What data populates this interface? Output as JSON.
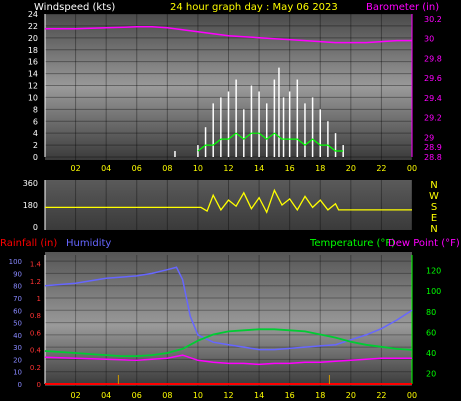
{
  "header": {
    "left": "Windspeed (kts)",
    "center": "24 hour graph day : May 06 2023",
    "right": "Barometer (in)"
  },
  "bottom_header": {
    "rainfall": "Rainfall (in)",
    "humidity": "Humidity",
    "temperature": "Temperature (°F)",
    "dewpoint": "Dew Point (°F)"
  },
  "colors": {
    "background": "#000000",
    "wind": "#ffffff",
    "gust": "#00ff00",
    "barometer": "#ff00ff",
    "direction": "#ffff00",
    "rain": "#ff0000",
    "humidity": "#6666ff",
    "temperature": "#00cc33",
    "dewpoint": "#ff00ff",
    "header": "#ffff00"
  },
  "chart_data": [
    {
      "type": "line",
      "name": "wind-barometer",
      "xticks": [
        "02",
        "04",
        "06",
        "08",
        "10",
        "12",
        "14",
        "16",
        "18",
        "20",
        "22",
        "00"
      ],
      "xlim": [
        0,
        24
      ],
      "y_left_ticks": [
        "0",
        "2",
        "4",
        "6",
        "8",
        "10",
        "12",
        "14",
        "16",
        "18",
        "20",
        "22",
        "24"
      ],
      "ylim_left": [
        0,
        24
      ],
      "y_right_ticks": [
        "28.8",
        "28.9",
        "29",
        "29.2",
        "29.4",
        "29.6",
        "29.8",
        "30",
        "30.2"
      ],
      "ylim_right": [
        28.8,
        30.25
      ],
      "barometer": {
        "x": [
          0,
          2,
          4,
          6,
          7,
          8,
          9,
          10,
          11,
          12,
          13,
          14,
          15,
          16,
          17,
          18,
          19,
          20,
          21,
          22,
          23,
          24
        ],
        "y": [
          30.1,
          30.1,
          30.11,
          30.12,
          30.12,
          30.11,
          30.09,
          30.07,
          30.05,
          30.03,
          30.02,
          30.01,
          30.0,
          29.99,
          29.98,
          29.97,
          29.96,
          29.96,
          29.96,
          29.97,
          29.98,
          29.98
        ]
      },
      "wind_avg": {
        "x": [
          10,
          10.5,
          11,
          11.5,
          12,
          12.5,
          13,
          13.5,
          14,
          14.5,
          15,
          15.5,
          16,
          16.5,
          17,
          17.5,
          18,
          18.5,
          19,
          19.5
        ],
        "y": [
          1,
          2,
          2,
          3,
          3,
          4,
          3,
          4,
          4,
          3,
          4,
          3,
          3,
          3,
          2,
          3,
          2,
          2,
          1,
          1
        ]
      },
      "wind_gust": {
        "x": [
          8.5,
          10,
          10.5,
          11,
          11.5,
          12,
          12.5,
          13,
          13.5,
          14,
          14.5,
          15,
          15.3,
          15.6,
          16,
          16.5,
          17,
          17.5,
          18,
          18.5,
          19,
          19.5
        ],
        "y": [
          1,
          2,
          5,
          9,
          10,
          11,
          13,
          8,
          12,
          11,
          9,
          13,
          15,
          10,
          11,
          13,
          9,
          10,
          8,
          6,
          4,
          2
        ]
      }
    },
    {
      "type": "line",
      "name": "wind-direction",
      "side_labels": [
        "N",
        "W",
        "S",
        "E",
        "N"
      ],
      "y_left_ticks": [
        "0",
        "180",
        "360"
      ],
      "ylim": [
        0,
        360
      ],
      "xlim": [
        0,
        24
      ],
      "direction": {
        "x": [
          0,
          4,
          8,
          10.2,
          10.6,
          11,
          11.5,
          12,
          12.5,
          13,
          13.5,
          14,
          14.5,
          15,
          15.5,
          16,
          16.5,
          17,
          17.5,
          18,
          18.5,
          19,
          19.2,
          20,
          22,
          24
        ],
        "y": [
          160,
          160,
          160,
          160,
          130,
          260,
          140,
          220,
          170,
          280,
          150,
          240,
          120,
          300,
          180,
          230,
          140,
          250,
          160,
          220,
          140,
          190,
          140,
          140,
          140,
          140
        ]
      }
    },
    {
      "type": "line",
      "name": "rain-humidity-temperature",
      "xticks": [
        "02",
        "04",
        "06",
        "08",
        "10",
        "12",
        "14",
        "16",
        "18",
        "20",
        "22",
        "00"
      ],
      "xlim": [
        0,
        24
      ],
      "y_rain_ticks": [
        "0",
        "0.2",
        "0.4",
        "0.6",
        "0.8",
        "1",
        "1.2",
        "1.4"
      ],
      "ylim_rain": [
        0,
        1.5
      ],
      "y_humidity_ticks": [
        "0",
        "10",
        "20",
        "30",
        "40",
        "50",
        "60",
        "70",
        "80",
        "90",
        "100"
      ],
      "ylim_humidity": [
        0,
        105
      ],
      "y_temp_ticks": [
        "20",
        "40",
        "60",
        "80",
        "100",
        "120"
      ],
      "ylim_temp": [
        10,
        135
      ],
      "rain": {
        "x": [
          0,
          24
        ],
        "y": [
          0,
          0
        ]
      },
      "rain_marks": {
        "x": [
          4.8,
          18.6
        ]
      },
      "humidity": {
        "x": [
          0,
          1,
          2,
          3,
          4,
          5,
          6,
          7,
          8,
          8.6,
          9,
          9.5,
          10,
          11,
          12,
          13,
          14,
          15,
          16,
          17,
          18,
          19,
          20,
          21,
          22,
          23,
          24
        ],
        "y": [
          80,
          81,
          82,
          84,
          86,
          87,
          88,
          90,
          93,
          95,
          85,
          55,
          40,
          34,
          32,
          30,
          28,
          28,
          29,
          30,
          31,
          32,
          36,
          40,
          45,
          52,
          60
        ]
      },
      "temperature": {
        "x": [
          0,
          1,
          2,
          3,
          4,
          5,
          6,
          7,
          8,
          9,
          10,
          11,
          12,
          13,
          14,
          15,
          16,
          17,
          18,
          19,
          20,
          21,
          22,
          23,
          24
        ],
        "y": [
          42,
          41,
          40,
          39,
          38,
          37,
          37,
          38,
          40,
          44,
          52,
          58,
          61,
          62,
          63,
          63,
          62,
          61,
          58,
          55,
          51,
          48,
          46,
          44,
          43
        ]
      },
      "dewpoint": {
        "x": [
          0,
          2,
          4,
          6,
          7,
          8,
          9,
          10,
          11,
          12,
          13,
          14,
          15,
          16,
          17,
          18,
          19,
          20,
          21,
          22,
          23,
          24
        ],
        "y": [
          36,
          35,
          34,
          33,
          34,
          35,
          38,
          33,
          31,
          30,
          30,
          29,
          30,
          30,
          31,
          31,
          32,
          33,
          34,
          35,
          35,
          35
        ]
      }
    }
  ]
}
